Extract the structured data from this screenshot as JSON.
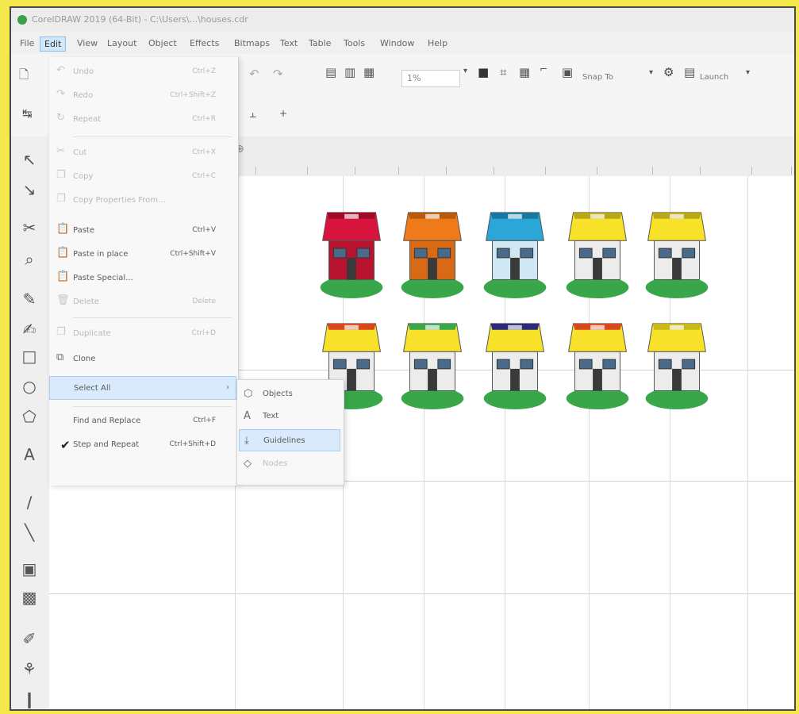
{
  "window": {
    "title": "CorelDRAW 2019 (64-Bit) - C:\\Users\\...\\houses.cdr"
  },
  "menubar": {
    "items": [
      {
        "label": "File"
      },
      {
        "label": "Edit"
      },
      {
        "label": "View"
      },
      {
        "label": "Layout"
      },
      {
        "label": "Object"
      },
      {
        "label": "Effects"
      },
      {
        "label": "Bitmaps"
      },
      {
        "label": "Text"
      },
      {
        "label": "Table"
      },
      {
        "label": "Tools"
      },
      {
        "label": "Window"
      },
      {
        "label": "Help"
      }
    ]
  },
  "toolbar": {
    "zoom_value": "1%",
    "snap_label": "Snap To",
    "launch_label": "Launch"
  },
  "edit_menu": {
    "items": [
      {
        "label": "Undo",
        "shortcut": "Ctrl+Z",
        "icon": "undo-icon"
      },
      {
        "label": "Redo",
        "shortcut": "Ctrl+Shift+Z",
        "icon": "redo-icon"
      },
      {
        "label": "Repeat",
        "shortcut": "Ctrl+R",
        "icon": "repeat-icon"
      },
      {
        "label": "Cut",
        "shortcut": "Ctrl+X",
        "icon": "cut-icon"
      },
      {
        "label": "Copy",
        "shortcut": "Ctrl+C",
        "icon": "copy-icon"
      },
      {
        "label": "Copy Properties From...",
        "shortcut": "",
        "icon": "copy-properties-icon"
      },
      {
        "label": "Paste",
        "shortcut": "Ctrl+V",
        "icon": "paste-icon"
      },
      {
        "label": "Paste in place",
        "shortcut": "Ctrl+Shift+V",
        "icon": "paste-in-place-icon"
      },
      {
        "label": "Paste Special...",
        "shortcut": "",
        "icon": "paste-special-icon"
      },
      {
        "label": "Delete",
        "shortcut": "Delete",
        "icon": "delete-icon"
      },
      {
        "label": "Duplicate",
        "shortcut": "Ctrl+D",
        "icon": "duplicate-icon"
      },
      {
        "label": "Clone",
        "shortcut": "",
        "icon": "clone-icon"
      },
      {
        "label": "Select All",
        "shortcut": "",
        "icon": ""
      },
      {
        "label": "Find and Replace",
        "shortcut": "Ctrl+F",
        "icon": ""
      },
      {
        "label": "Step and Repeat",
        "shortcut": "Ctrl+Shift+D",
        "icon": ""
      }
    ]
  },
  "select_all_submenu": {
    "items": [
      {
        "label": "Objects",
        "icon": "objects-icon"
      },
      {
        "label": "Text",
        "icon": "text-icon"
      },
      {
        "label": "Guidelines",
        "icon": "guidelines-icon"
      },
      {
        "label": "Nodes",
        "icon": "nodes-icon"
      }
    ]
  },
  "colors": {
    "highlight": "#d8eafc",
    "grass": "#3aa64a",
    "roof_red": "#d8143c",
    "roof_orange": "#ee7a1a",
    "roof_blue": "#2aa6d8",
    "roof_yellow": "#f7e229"
  },
  "houses": [
    {
      "row": 1,
      "col": 1,
      "roof": "#d8143c",
      "roof_edge": "#a00a28",
      "wall": "#b81430"
    },
    {
      "row": 1,
      "col": 2,
      "roof": "#ee7a1a",
      "roof_edge": "#b85a0a",
      "wall": "#d86a16"
    },
    {
      "row": 1,
      "col": 3,
      "roof": "#2aa6d8",
      "roof_edge": "#1a78a0",
      "wall": "#d0e8f4"
    },
    {
      "row": 1,
      "col": 4,
      "roof": "#f7e229",
      "roof_edge": "#b8a818",
      "wall": "#ececec"
    },
    {
      "row": 1,
      "col": 5,
      "roof": "#f7e229",
      "roof_edge": "#b8a818",
      "wall": "#ececec"
    },
    {
      "row": 2,
      "col": 1,
      "roof": "#f7e229",
      "roof_edge": "#d8481c",
      "wall": "#ececec"
    },
    {
      "row": 2,
      "col": 2,
      "roof": "#f7e229",
      "roof_edge": "#3aa64a",
      "wall": "#ececec"
    },
    {
      "row": 2,
      "col": 3,
      "roof": "#f7e229",
      "roof_edge": "#2a2a78",
      "wall": "#ececec"
    },
    {
      "row": 2,
      "col": 4,
      "roof": "#f7e229",
      "roof_edge": "#d8481c",
      "wall": "#ececec"
    },
    {
      "row": 2,
      "col": 5,
      "roof": "#f7e229",
      "roof_edge": "#c8b818",
      "wall": "#ececec"
    }
  ]
}
